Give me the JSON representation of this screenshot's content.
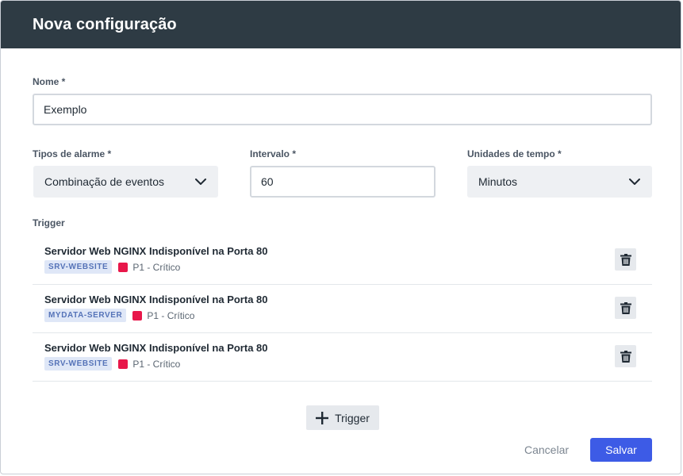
{
  "header": {
    "title": "Nova configuração"
  },
  "form": {
    "name": {
      "label": "Nome *",
      "value": "Exemplo"
    },
    "alarm_type": {
      "label": "Tipos de alarme *",
      "value": "Combinação de eventos"
    },
    "interval": {
      "label": "Intervalo *",
      "value": "60"
    },
    "time_unit": {
      "label": "Unidades de tempo *",
      "value": "Minutos"
    },
    "trigger_label": "Trigger"
  },
  "triggers": [
    {
      "title": "Servidor Web NGINX Indisponível na Porta 80",
      "host": "SRV-WEBSITE",
      "severity": "P1 - Crítico"
    },
    {
      "title": "Servidor Web NGINX Indisponível na Porta 80",
      "host": "MYDATA-SERVER",
      "severity": "P1 - Crítico"
    },
    {
      "title": "Servidor Web NGINX Indisponível na Porta 80",
      "host": "SRV-WEBSITE",
      "severity": "P1 - Crítico"
    }
  ],
  "actions": {
    "add_trigger": "Trigger",
    "cancel": "Cancelar",
    "save": "Salvar"
  },
  "colors": {
    "header_bg": "#2e3b44",
    "primary": "#3d5be6",
    "severity_critical": "#e8174a",
    "host_tag_bg": "#dfe7f7"
  },
  "icons": {
    "dropdown": "chevron-down-icon",
    "delete": "trash-icon",
    "add": "plus-icon"
  }
}
